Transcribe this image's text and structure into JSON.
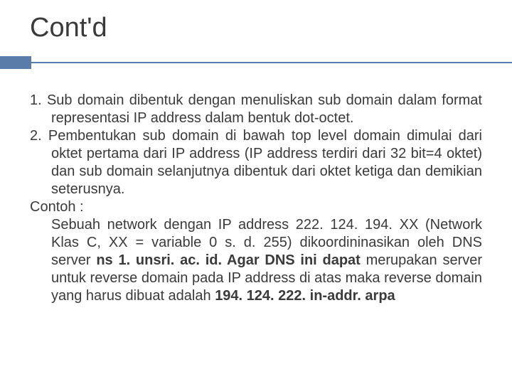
{
  "title": "Cont'd",
  "item1": "1. Sub domain dibentuk dengan menuliskan sub domain dalam format representasi IP address dalam bentuk dot-octet.",
  "item2": "2. Pembentukan sub domain di bawah top level domain dimulai dari oktet pertama dari IP address (IP address terdiri dari 32 bit=4 oktet) dan sub domain selanjutnya dibentuk dari oktet ketiga dan demikian seterusnya.",
  "example_label": "Contoh :",
  "example_part1": "Sebuah network dengan IP address 222. 124. 194. XX (Network Klas C, XX = variable 0 s. d. 255) dikoordininasikan oleh DNS server ",
  "example_bold1": "ns 1. unsri. ac. id. Agar DNS ini dapat ",
  "example_part2": "merupakan server untuk reverse domain pada IP address di atas maka reverse domain yang harus dibuat adalah ",
  "example_bold2": "194. 124. 222. in-addr. arpa"
}
